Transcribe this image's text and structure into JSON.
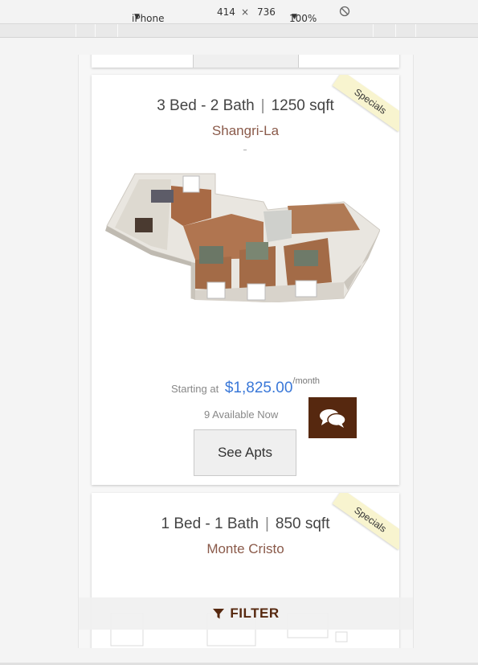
{
  "devtools": {
    "device": "iPhone 6 Pl...",
    "width": "414",
    "separator": "×",
    "height": "736",
    "zoom": "100%"
  },
  "listing_main": {
    "ribbon": "Specials",
    "beds": "3 Bed - 2 Bath",
    "divider": "|",
    "sqft": "1250 sqft",
    "name": "Shangri-La",
    "starting_at": "Starting at",
    "price": "$1,825.00",
    "per": "/month",
    "available": "9 Available Now",
    "see_apts": "See Apts"
  },
  "listing_next": {
    "ribbon": "Specials",
    "beds": "1 Bed - 1 Bath",
    "divider": "|",
    "sqft": "850 sqft",
    "name": "Monte Cristo"
  },
  "filter": {
    "label": "FILTER"
  },
  "colors": {
    "accent": "#56280f",
    "price": "#3a78d8",
    "community": "#8a5a4a",
    "ribbon": "#f8f4cf"
  }
}
